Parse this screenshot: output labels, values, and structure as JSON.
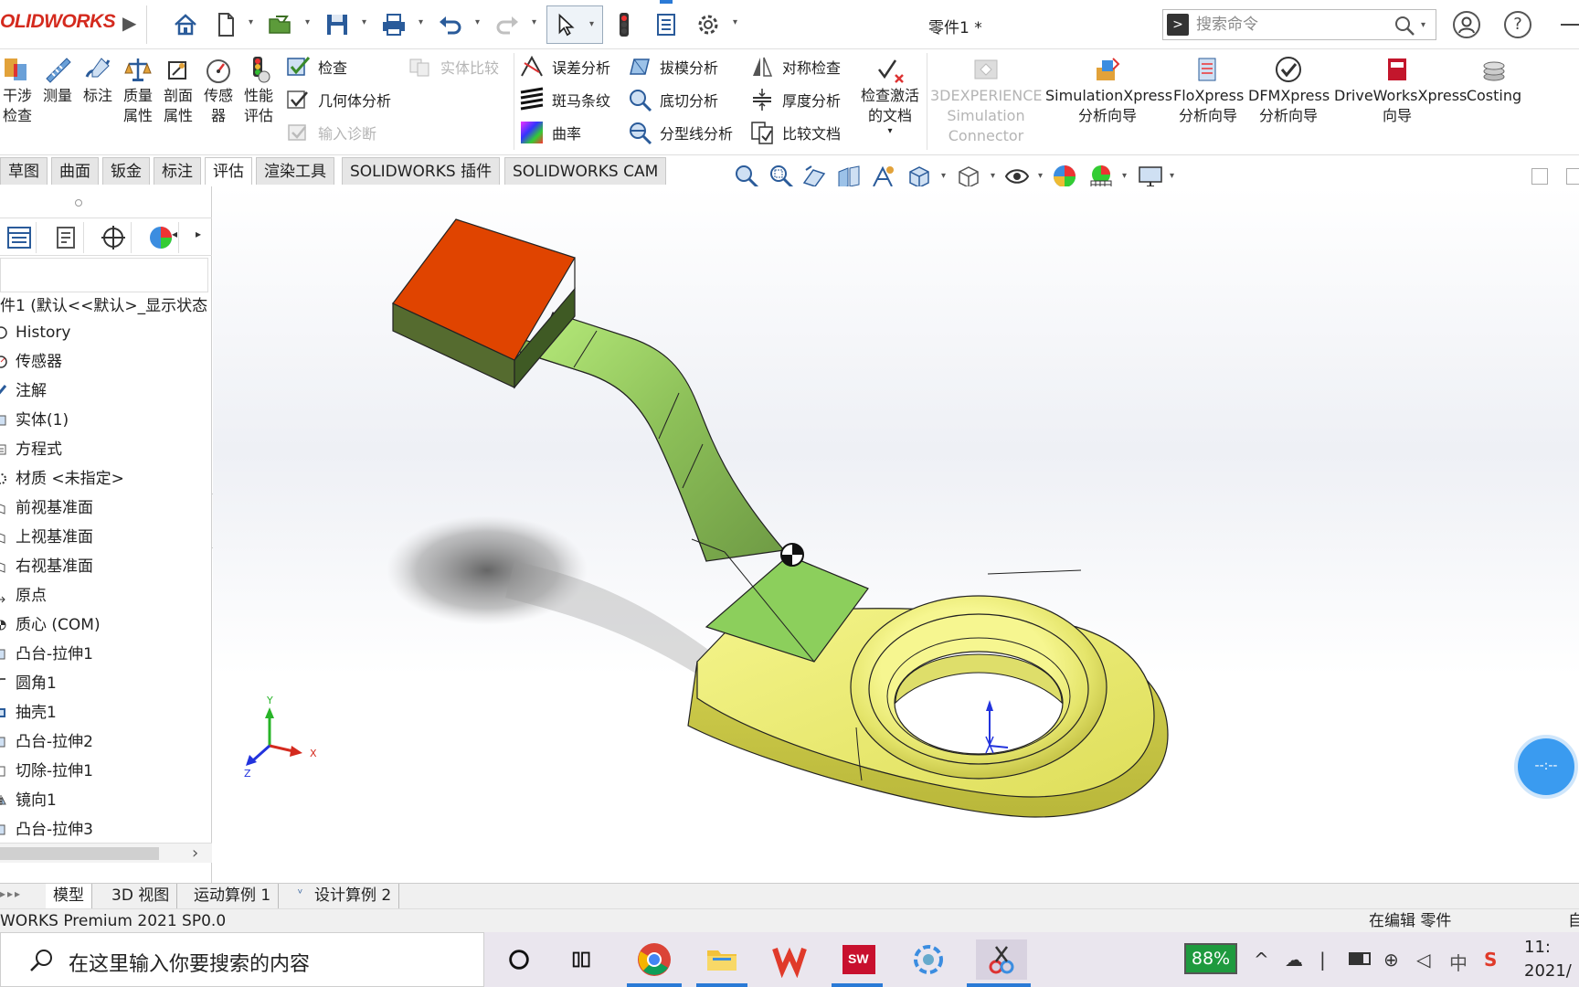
{
  "app": {
    "logo_text": "OLIDWORKS",
    "document_title": "零件1 *",
    "brand_color": "#d42a1e",
    "accent_color": "#1f6fc4"
  },
  "search": {
    "placeholder": "搜索命令"
  },
  "ribbon": {
    "big_buttons": [
      {
        "label_line1": "干涉",
        "label_line2": "检查",
        "icon": "interference-icon"
      },
      {
        "label_line1": "测量",
        "label_line2": "",
        "icon": "measure-icon"
      },
      {
        "label_line1": "标注",
        "label_line2": "",
        "icon": "markup-icon"
      },
      {
        "label_line1": "质量",
        "label_line2": "属性",
        "icon": "mass-props-icon"
      },
      {
        "label_line1": "剖面",
        "label_line2": "属性",
        "icon": "section-props-icon"
      },
      {
        "label_line1": "传感",
        "label_line2": "器",
        "icon": "sensor-icon"
      },
      {
        "label_line1": "性能",
        "label_line2": "评估",
        "icon": "performance-icon"
      }
    ],
    "check": "检查",
    "geometry_analysis": "几何体分析",
    "import_diagnostics": "输入诊断",
    "compare_solid": "实体比较",
    "deviation_analysis": "误差分析",
    "zebra_stripes": "斑马条纹",
    "curvature": "曲率",
    "draft_analysis": "拔模分析",
    "undercut_analysis": "底切分析",
    "parting_line_analysis": "分型线分析",
    "symmetry_check": "对称检查",
    "thickness_analysis": "厚度分析",
    "compare_documents": "比较文档",
    "check_active_doc_line1": "检查激活",
    "check_active_doc_line2": "的文档",
    "addins": [
      {
        "line1": "3DEXPERIENCE",
        "line2": "Simulation",
        "line3": "Connector",
        "disabled": true
      },
      {
        "line1": "SimulationXpress",
        "line2": "分析向导",
        "line3": "",
        "disabled": false
      },
      {
        "line1": "FloXpress",
        "line2": "分析向导",
        "line3": "",
        "disabled": false
      },
      {
        "line1": "DFMXpress",
        "line2": "分析向导",
        "line3": "",
        "disabled": false
      },
      {
        "line1": "DriveWorksXpress",
        "line2": "向导",
        "line3": "",
        "disabled": false
      },
      {
        "line1": "Costing",
        "line2": "",
        "line3": "",
        "disabled": false
      }
    ]
  },
  "tabs": [
    "草图",
    "曲面",
    "钣金",
    "标注",
    "评估",
    "渲染工具",
    "SOLIDWORKS 插件",
    "SOLIDWORKS CAM"
  ],
  "active_tab": "评估",
  "feature_tree": {
    "root": "件1 (默认<<默认>_显示状态",
    "items": [
      {
        "label": "History",
        "icon": "history-icon"
      },
      {
        "label": "传感器",
        "icon": "sensor-folder-icon"
      },
      {
        "label": "注解",
        "icon": "annotation-icon"
      },
      {
        "label": "实体(1)",
        "icon": "solid-bodies-icon"
      },
      {
        "label": "方程式",
        "icon": "equations-icon"
      },
      {
        "label": "材质 <未指定>",
        "icon": "material-icon"
      },
      {
        "label": "前视基准面",
        "icon": "plane-icon"
      },
      {
        "label": "上视基准面",
        "icon": "plane-icon"
      },
      {
        "label": "右视基准面",
        "icon": "plane-icon"
      },
      {
        "label": "原点",
        "icon": "origin-icon"
      },
      {
        "label": "质心 (COM)",
        "icon": "com-icon"
      },
      {
        "label": "凸台-拉伸1",
        "icon": "extrude-icon"
      },
      {
        "label": "圆角1",
        "icon": "fillet-icon"
      },
      {
        "label": "抽壳1",
        "icon": "shell-icon"
      },
      {
        "label": "凸台-拉伸2",
        "icon": "extrude-icon"
      },
      {
        "label": "切除-拉伸1",
        "icon": "cut-extrude-icon"
      },
      {
        "label": "镜向1",
        "icon": "mirror-icon"
      },
      {
        "label": "凸台-拉伸3",
        "icon": "extrude-icon"
      }
    ]
  },
  "viewport": {
    "colors": {
      "top_block": "#e04400",
      "bent_strip": "#8fcf5c",
      "ring_base": "#eaea6a"
    },
    "triad": {
      "x": "X",
      "y": "Y",
      "z": "Z"
    },
    "help_bubble": "--:--"
  },
  "bottom_tabs": [
    "模型",
    "3D 视图",
    "运动算例 1",
    "设计算例 2"
  ],
  "active_bottom_tab": "模型",
  "status": {
    "left": "WORKS Premium 2021 SP0.0",
    "right": "在编辑 零件",
    "edge": "自"
  },
  "taskbar": {
    "search_label": "在这里输入你要搜索的内容",
    "battery": "88%",
    "ime": "中",
    "clock_line1": "11:",
    "clock_line2": "2021/"
  }
}
